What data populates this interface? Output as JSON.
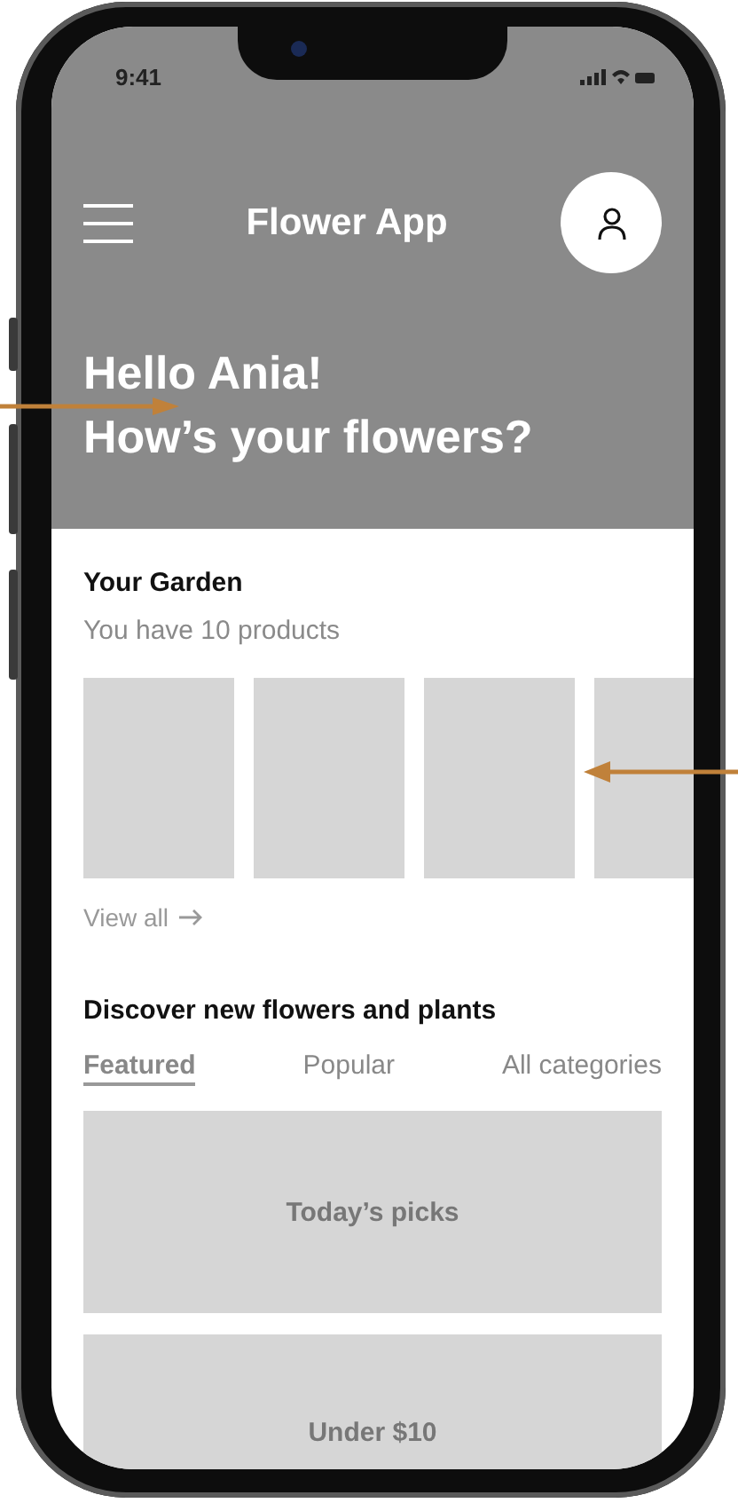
{
  "status_bar": {
    "time": "9:41"
  },
  "header": {
    "title": "Flower App",
    "greeting": [
      "Hello Ania!",
      "How’s your flowers?"
    ]
  },
  "garden": {
    "title": "Your Garden",
    "subtitle": "You have 10 products",
    "tiles": [
      {
        "kind": "placeholder"
      },
      {
        "kind": "placeholder"
      },
      {
        "kind": "placeholder"
      },
      {
        "kind": "placeholder"
      }
    ],
    "link": "View all"
  },
  "discover": {
    "title": "Discover new flowers and plants",
    "tabs": [
      {
        "label": "Featured",
        "selected": true
      },
      {
        "label": "Popular",
        "selected": false
      },
      {
        "label": "All categories",
        "selected": false
      }
    ],
    "cards": [
      {
        "label": "Today’s picks"
      },
      {
        "label": "Under $10"
      }
    ]
  }
}
